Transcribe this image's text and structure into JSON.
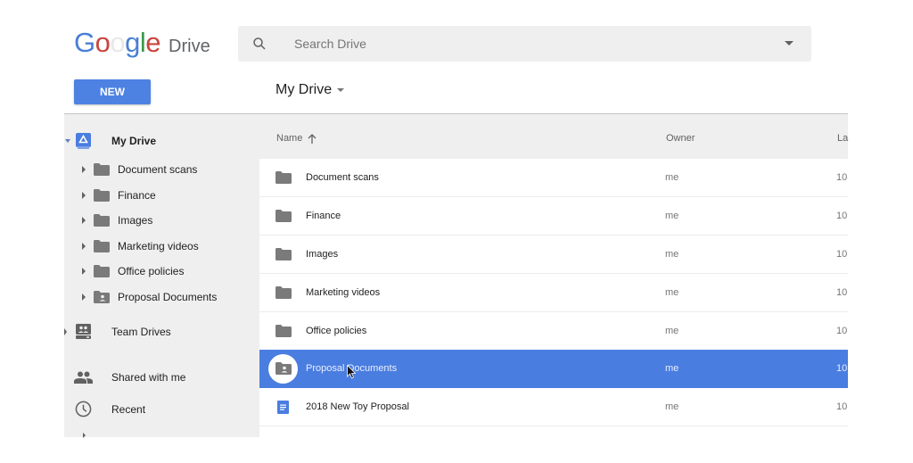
{
  "app": {
    "logo_letters": [
      "G",
      "o",
      "o",
      "g",
      "l",
      "e"
    ],
    "product_name": "Drive"
  },
  "search": {
    "placeholder": "Search Drive",
    "value": "",
    "icon": "search-icon",
    "options_icon": "caret-down-icon"
  },
  "toolbar": {
    "new_label": "NEW",
    "page_title": "My Drive",
    "title_icon": "caret-down-icon"
  },
  "sidebar": {
    "my_drive": {
      "label": "My Drive",
      "icon": "my-drive-icon",
      "expanded": true
    },
    "folders": [
      {
        "label": "Document scans",
        "icon": "folder-icon"
      },
      {
        "label": "Finance",
        "icon": "folder-icon"
      },
      {
        "label": "Images",
        "icon": "folder-icon"
      },
      {
        "label": "Marketing videos",
        "icon": "folder-icon"
      },
      {
        "label": "Office policies",
        "icon": "folder-icon"
      },
      {
        "label": "Proposal Documents",
        "icon": "shared-folder-icon"
      }
    ],
    "items": [
      {
        "label": "Team Drives",
        "icon": "team-drives-icon"
      },
      {
        "label": "Shared with me",
        "icon": "people-icon"
      },
      {
        "label": "Recent",
        "icon": "clock-icon"
      }
    ]
  },
  "file_list": {
    "columns": {
      "name": "Name",
      "sort_icon": "arrow-up-icon",
      "owner": "Owner",
      "last_modified": "La"
    },
    "rows": [
      {
        "name": "Document scans",
        "owner": "me",
        "modified": "10",
        "icon": "folder-icon",
        "selected": false
      },
      {
        "name": "Finance",
        "owner": "me",
        "modified": "10",
        "icon": "folder-icon",
        "selected": false
      },
      {
        "name": "Images",
        "owner": "me",
        "modified": "10",
        "icon": "folder-icon",
        "selected": false
      },
      {
        "name": "Marketing videos",
        "owner": "me",
        "modified": "10",
        "icon": "folder-icon",
        "selected": false
      },
      {
        "name": "Office policies",
        "owner": "me",
        "modified": "10",
        "icon": "folder-icon",
        "selected": false
      },
      {
        "name": "Proposal Documents",
        "owner": "me",
        "modified": "10",
        "icon": "shared-folder-icon",
        "selected": true
      },
      {
        "name": "2018 New Toy Proposal",
        "owner": "me",
        "modified": "10",
        "icon": "google-doc-icon",
        "selected": false
      }
    ]
  },
  "colors": {
    "accent": "#4d82e3",
    "selection": "#4a7de0",
    "sidebar_bg": "#efefef",
    "folder_gray": "#7a7a7a",
    "doc_blue": "#4a7de0"
  }
}
